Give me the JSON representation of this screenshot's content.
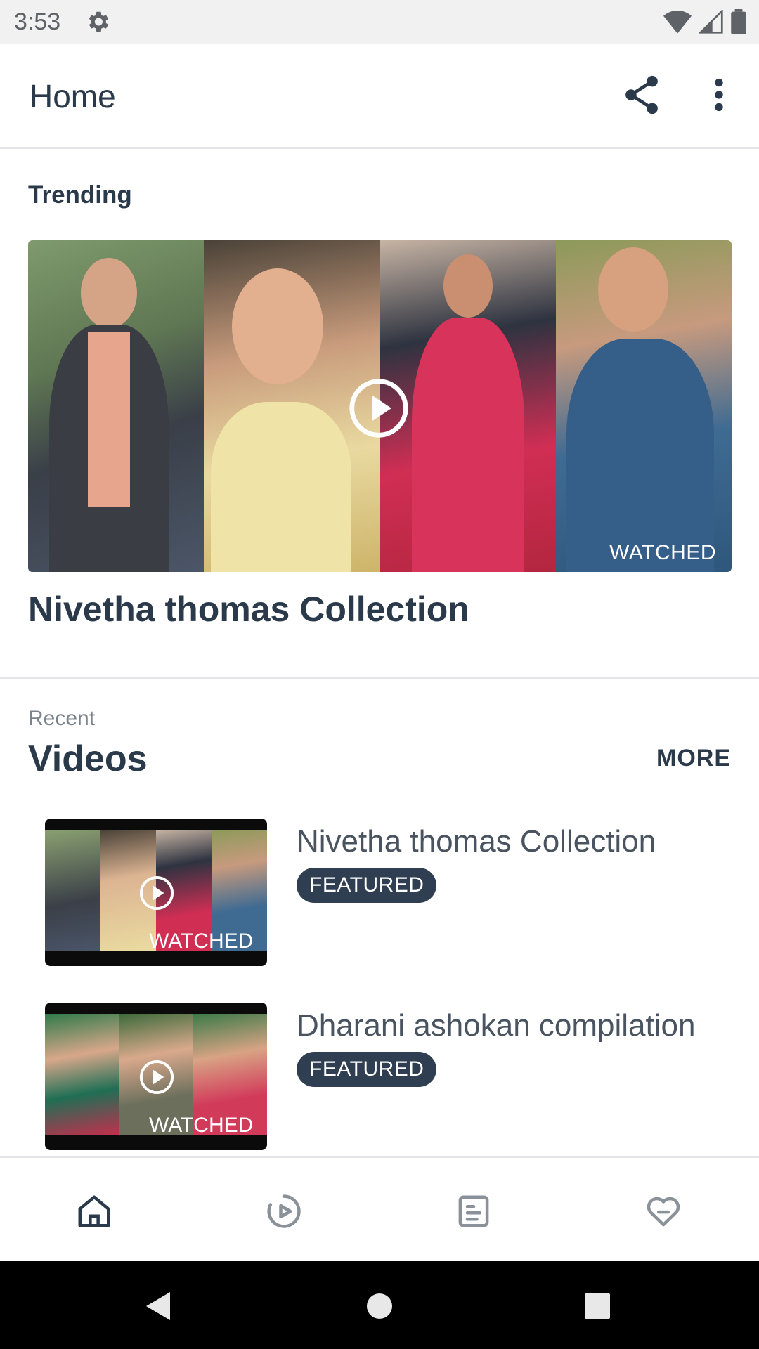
{
  "status_bar": {
    "time": "3:53",
    "icons": [
      "gear-icon",
      "wifi-icon",
      "signal-icon",
      "battery-icon"
    ]
  },
  "app_bar": {
    "title": "Home",
    "actions": [
      "share-icon",
      "more-vert-icon"
    ]
  },
  "trending": {
    "label": "Trending",
    "card": {
      "title": "Nivetha thomas Collection",
      "status": "WATCHED"
    }
  },
  "recent": {
    "label": "Recent",
    "heading": "Videos",
    "more_label": "MORE",
    "items": [
      {
        "title": "Nivetha thomas Collection",
        "badge": "FEATURED",
        "status": "WATCHED"
      },
      {
        "title": "Dharani ashokan compilation",
        "badge": "FEATURED",
        "status": "WATCHED"
      }
    ]
  },
  "bottom_nav": {
    "items": [
      "home-icon",
      "play-circle-icon",
      "article-icon",
      "heart-icon"
    ]
  },
  "colors": {
    "text_primary": "#2b3a4a",
    "badge_bg": "#2f3e50",
    "divider": "#e3e5e8"
  }
}
